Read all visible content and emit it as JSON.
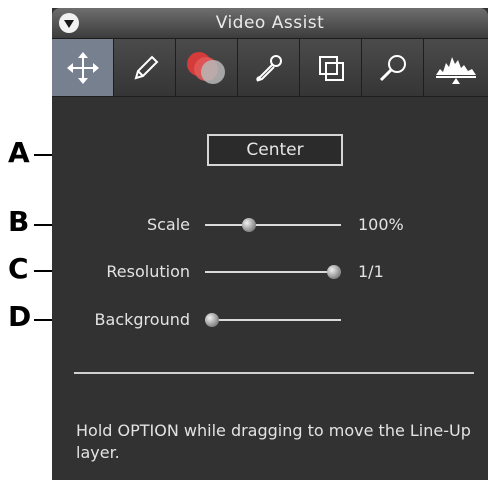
{
  "window": {
    "title": "Video Assist"
  },
  "toolbar": {
    "tools": [
      {
        "name": "move-tool",
        "icon": "move-arrows-icon",
        "active": true
      },
      {
        "name": "pencil-tool",
        "icon": "pencil-icon",
        "active": false
      },
      {
        "name": "overlay-tool",
        "icon": "overlapping-circles-icon",
        "active": false
      },
      {
        "name": "eyedropper-tool",
        "icon": "eyedropper-icon",
        "active": false
      },
      {
        "name": "layers-tool",
        "icon": "stacked-squares-icon",
        "active": false
      },
      {
        "name": "magnifier-tool",
        "icon": "magnifier-icon",
        "active": false
      },
      {
        "name": "histogram-tool",
        "icon": "histogram-icon",
        "active": false
      }
    ]
  },
  "controls": {
    "center_label": "Center",
    "scale": {
      "label": "Scale",
      "value": "100%",
      "level": 0.3
    },
    "resolution": {
      "label": "Resolution",
      "value": "1/1",
      "level": 1.0
    },
    "background": {
      "label": "Background",
      "level": 0.0
    }
  },
  "help_text": "Hold OPTION while dragging to move the Line-Up layer.",
  "callouts": {
    "a": "A",
    "b": "B",
    "c": "C",
    "d": "D"
  }
}
